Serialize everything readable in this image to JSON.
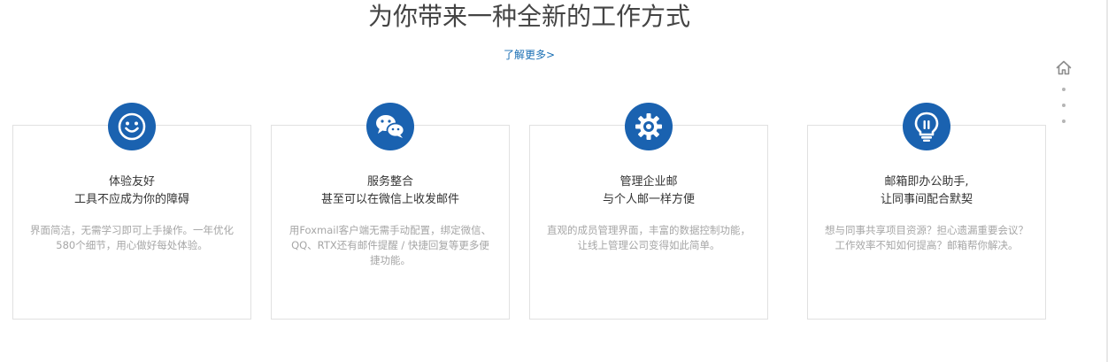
{
  "headline": "为你带来一种全新的工作方式",
  "learn_more": "了解更多>",
  "cards": [
    {
      "icon": "smiley-icon",
      "title_line1": "体验友好",
      "title_line2": "工具不应成为你的障碍",
      "description": "界面简洁，无需学习即可上手操作。一年优化580个细节，用心做好每处体验。"
    },
    {
      "icon": "wechat-icon",
      "title_line1": "服务整合",
      "title_line2": "甚至可以在微信上收发邮件",
      "description": "用Foxmail客户端无需手动配置，绑定微信、QQ、RTX还有邮件提醒 / 快捷回复等更多便捷功能。"
    },
    {
      "icon": "gear-icon",
      "title_line1": "管理企业邮",
      "title_line2": "与个人邮一样方便",
      "description": "直观的成员管理界面，丰富的数据控制功能，让线上管理公司变得如此简单。"
    },
    {
      "icon": "lightbulb-icon",
      "title_line1": "邮箱即办公助手,",
      "title_line2": "让同事间配合默契",
      "description": "想与同事共享项目资源？担心遗漏重要会议？工作效率不知如何提高？邮箱帮你解决。"
    }
  ],
  "side_nav": {
    "home_icon": "home-icon",
    "dots": 3
  },
  "colors": {
    "accent": "#1a62b0",
    "link": "#1a6fb4",
    "heading": "#444444",
    "muted": "#a6a6a6"
  }
}
